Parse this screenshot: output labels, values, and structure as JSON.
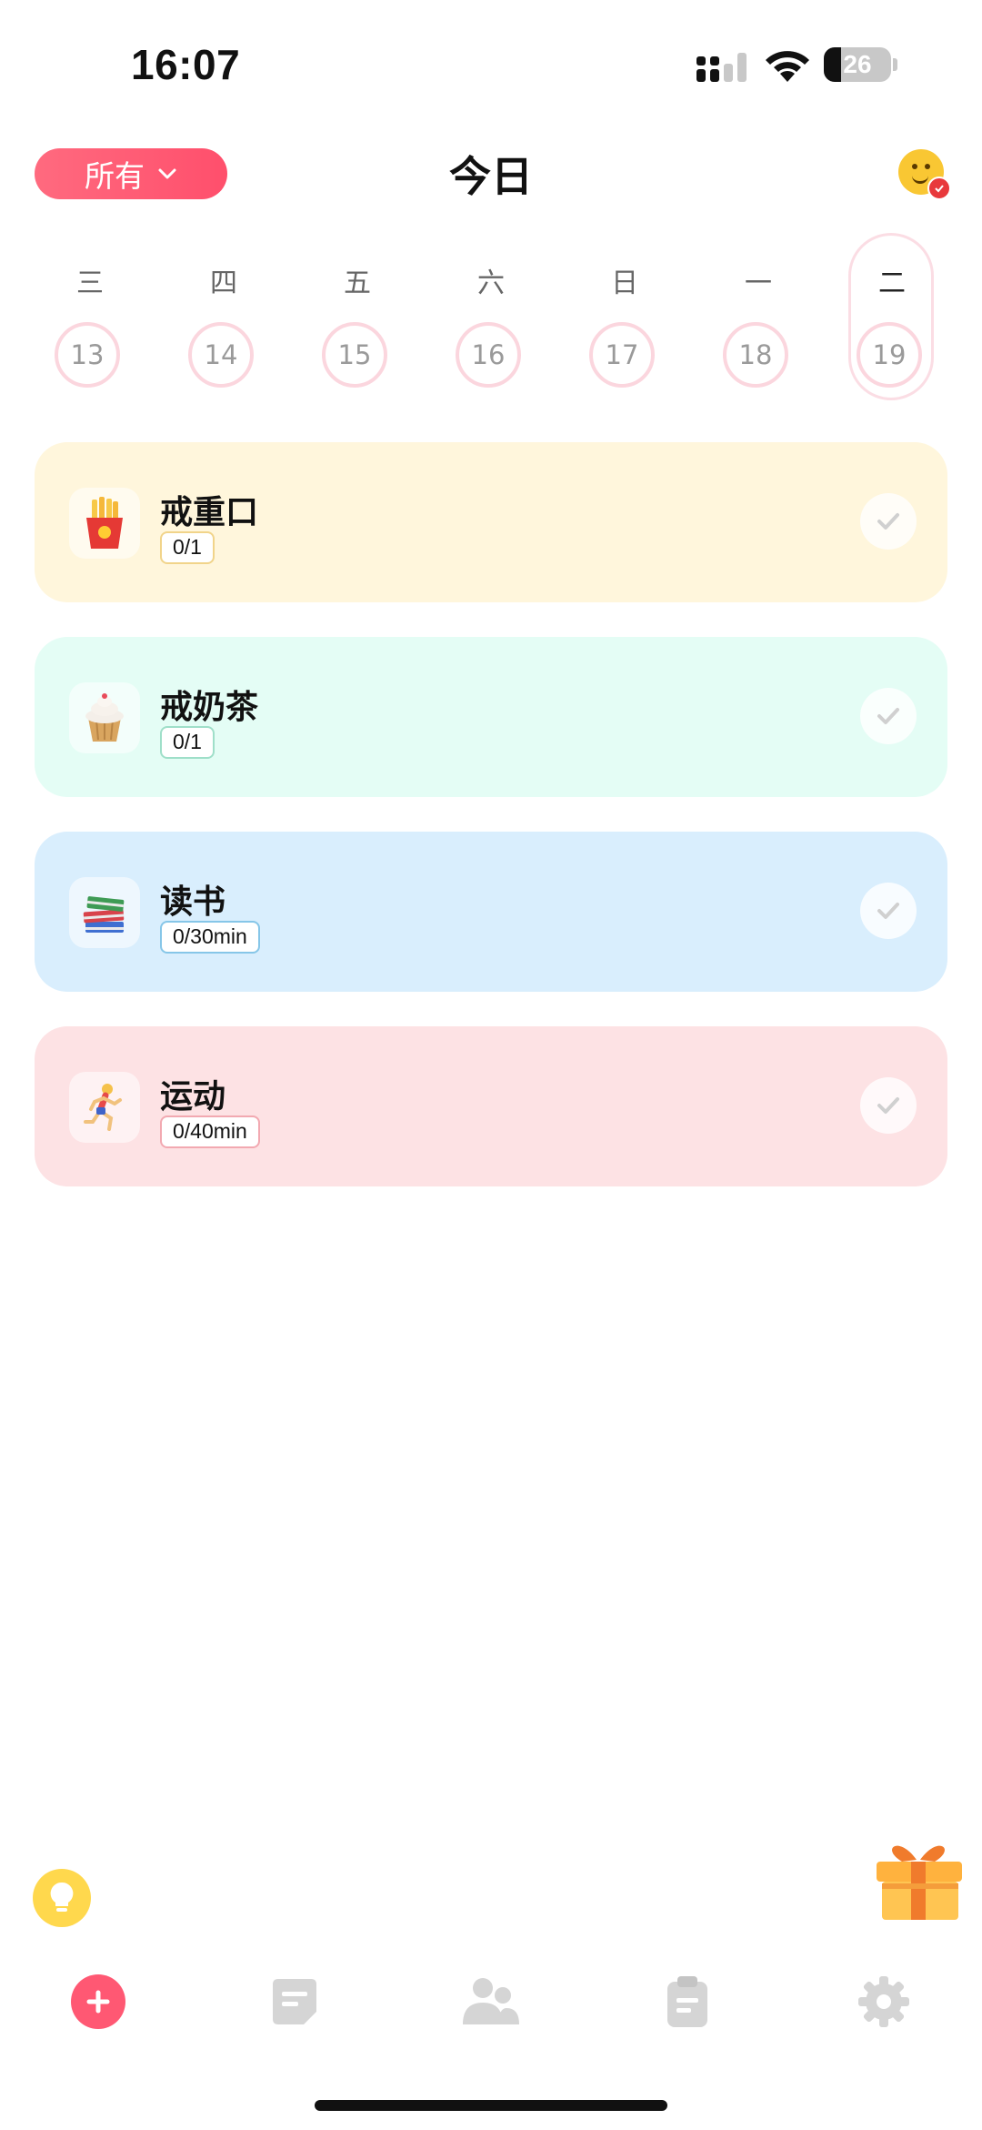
{
  "status_bar": {
    "time": "16:07",
    "battery_percent": "26",
    "battery_level": 0.26
  },
  "header": {
    "filter_label": "所有",
    "title": "今日"
  },
  "week": [
    {
      "weekday": "三",
      "date": "13",
      "selected": false
    },
    {
      "weekday": "四",
      "date": "14",
      "selected": false
    },
    {
      "weekday": "五",
      "date": "15",
      "selected": false
    },
    {
      "weekday": "六",
      "date": "16",
      "selected": false
    },
    {
      "weekday": "日",
      "date": "17",
      "selected": false
    },
    {
      "weekday": "一",
      "date": "18",
      "selected": false
    },
    {
      "weekday": "二",
      "date": "19",
      "selected": true
    }
  ],
  "habits": [
    {
      "name": "戒重口",
      "progress": "0/1",
      "icon": "fries-icon",
      "bg_color": "#fff6dc",
      "tag_border": "#f1d48a"
    },
    {
      "name": "戒奶茶",
      "progress": "0/1",
      "icon": "cupcake-icon",
      "bg_color": "#e4fdf5",
      "tag_border": "#9fdfc9"
    },
    {
      "name": "读书",
      "progress": "0/30min",
      "icon": "books-icon",
      "bg_color": "#d9eefd",
      "tag_border": "#86c6e8"
    },
    {
      "name": "运动",
      "progress": "0/40min",
      "icon": "runner-icon",
      "bg_color": "#fde2e4",
      "tag_border": "#f2a9b1"
    }
  ],
  "tabbar": [
    "add-icon",
    "notes-icon",
    "friends-icon",
    "clipboard-icon",
    "settings-icon"
  ],
  "colors": {
    "accent": "#ff5873",
    "ring": "#fbd6de",
    "tab_inactive": "#d5d5d5"
  }
}
